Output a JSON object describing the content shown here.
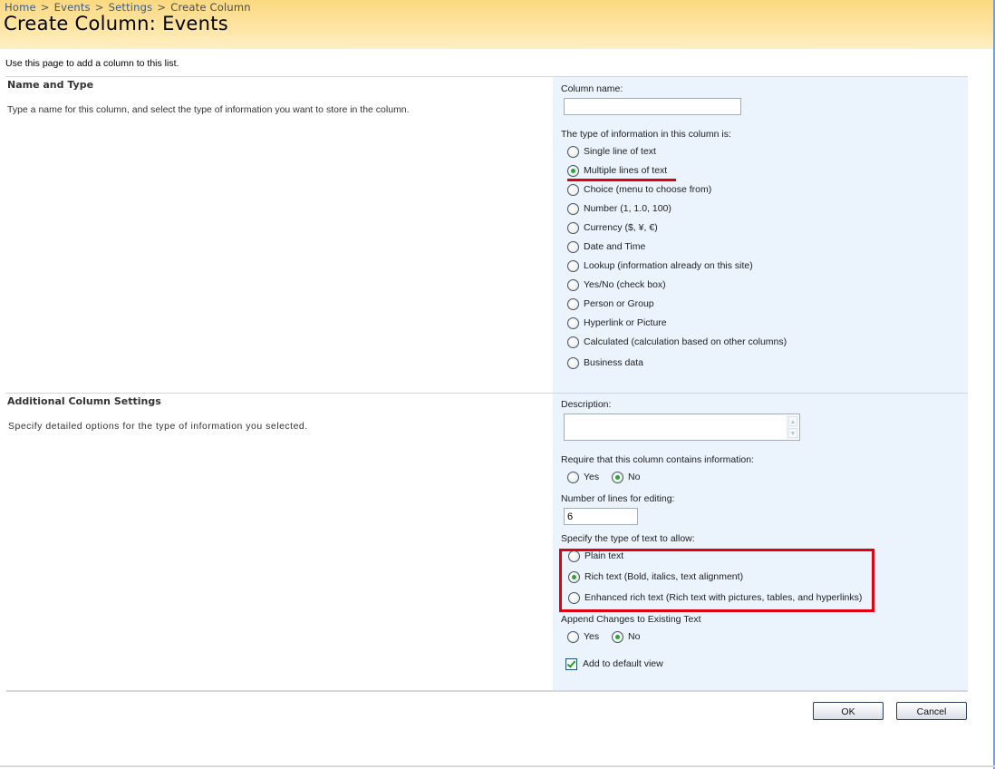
{
  "header": {
    "breadcrumb": [
      {
        "label": "Home"
      },
      {
        "label": "Events"
      },
      {
        "label": "Settings"
      },
      {
        "label": "Create Column"
      }
    ],
    "breadcrumb_separator": ">",
    "title": "Create Column: Events"
  },
  "intro": "Use this page to add a column to this list.",
  "sections": {
    "name_type": {
      "title": "Name and Type",
      "description": "Type a name for this column, and select the type of information you want to store in the column."
    },
    "additional": {
      "title": "Additional Column Settings",
      "description": "Specify detailed options for the type of information you selected."
    }
  },
  "form": {
    "column_name_label": "Column name:",
    "column_name_value": "",
    "type_label": "The type of information in this column is:",
    "types": [
      {
        "label": "Single line of text",
        "checked": false
      },
      {
        "label": "Multiple lines of text",
        "checked": true
      },
      {
        "label": "Choice (menu to choose from)",
        "checked": false
      },
      {
        "label": "Number (1, 1.0, 100)",
        "checked": false
      },
      {
        "label": "Currency ($, ¥, €)",
        "checked": false
      },
      {
        "label": "Date and Time",
        "checked": false
      },
      {
        "label": "Lookup (information already on this site)",
        "checked": false
      },
      {
        "label": "Yes/No (check box)",
        "checked": false
      },
      {
        "label": "Person or Group",
        "checked": false
      },
      {
        "label": "Hyperlink or Picture",
        "checked": false
      },
      {
        "label": "Calculated (calculation based on other columns)",
        "checked": false
      },
      {
        "label": "Business data",
        "checked": false
      }
    ],
    "description_label": "Description:",
    "description_value": "",
    "require_label": "Require that this column contains information:",
    "require_options": [
      {
        "label": "Yes",
        "checked": false
      },
      {
        "label": "No",
        "checked": true
      }
    ],
    "lines_label": "Number of lines for editing:",
    "lines_value": "6",
    "text_type_label": "Specify the type of text to allow:",
    "text_types": [
      {
        "label": "Plain text",
        "checked": false
      },
      {
        "label": "Rich text (Bold, italics, text alignment)",
        "checked": true
      },
      {
        "label": "Enhanced rich text (Rich text with pictures, tables, and hyperlinks)",
        "checked": false
      }
    ],
    "append_label": "Append Changes to Existing Text",
    "append_options": [
      {
        "label": "Yes",
        "checked": false
      },
      {
        "label": "No",
        "checked": true
      }
    ],
    "default_view_label": "Add to default view",
    "default_view_checked": true
  },
  "buttons": {
    "ok": "OK",
    "cancel": "Cancel"
  },
  "colors": {
    "annotation_red": "#e00010",
    "panel_bg": "#ebf3fd",
    "header_gold": "#fbd97f",
    "radio_checked": "#29a53a"
  }
}
